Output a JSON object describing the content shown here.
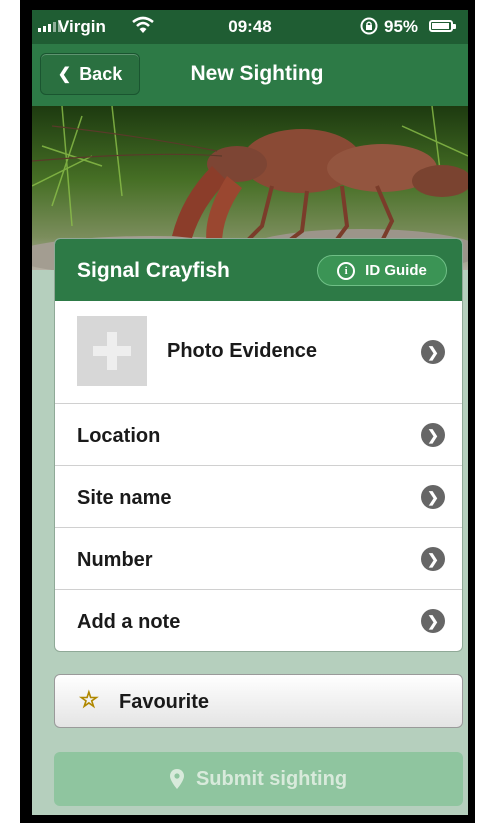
{
  "status_bar": {
    "carrier": "Virgin",
    "time": "09:48",
    "battery_percent": "95%"
  },
  "nav": {
    "back_label": "Back",
    "title": "New Sighting"
  },
  "card": {
    "species": "Signal Crayfish",
    "id_guide_label": "ID Guide",
    "rows": [
      {
        "label": "Photo Evidence"
      },
      {
        "label": "Location"
      },
      {
        "label": "Site name"
      },
      {
        "label": "Number"
      },
      {
        "label": "Add a note"
      }
    ]
  },
  "favourite_label": "Favourite",
  "submit_label": "Submit sighting",
  "colors": {
    "brand_green": "#2d7a46",
    "background": "#b5cfbd",
    "submit_disabled": "#8fc59f",
    "star": "#f2c200"
  }
}
